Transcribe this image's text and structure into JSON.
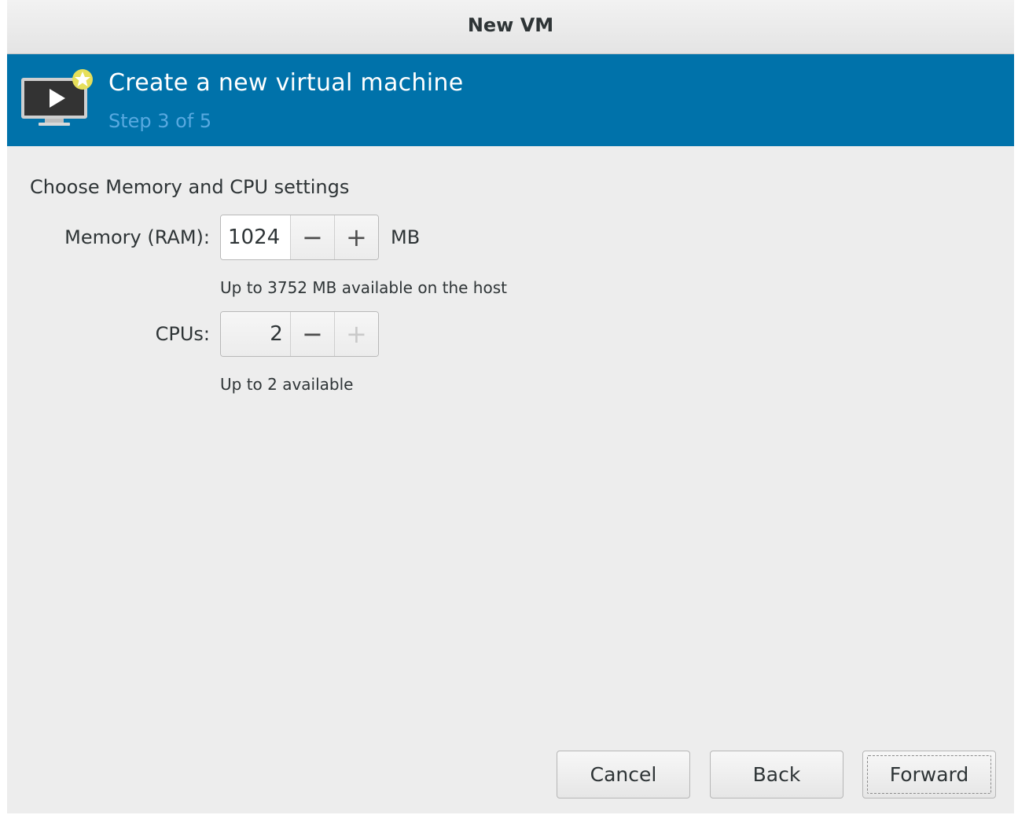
{
  "window": {
    "title": "New VM"
  },
  "banner": {
    "heading": "Create a new virtual machine",
    "step": "Step 3 of 5",
    "icon": "vm-display-icon"
  },
  "form": {
    "section_title": "Choose Memory and CPU settings",
    "memory": {
      "label": "Memory (RAM):",
      "value": "1024",
      "unit": "MB",
      "hint": "Up to 3752 MB available on the host",
      "decrement_enabled": true,
      "increment_enabled": true
    },
    "cpus": {
      "label": "CPUs:",
      "value": "2",
      "hint": "Up to 2 available",
      "decrement_enabled": true,
      "increment_enabled": false
    },
    "minus_glyph": "−",
    "plus_glyph": "+"
  },
  "buttons": {
    "cancel": "Cancel",
    "back": "Back",
    "forward": "Forward"
  },
  "colors": {
    "banner_bg": "#0072aa",
    "step_text": "#58a9e0",
    "window_bg": "#ededed"
  }
}
